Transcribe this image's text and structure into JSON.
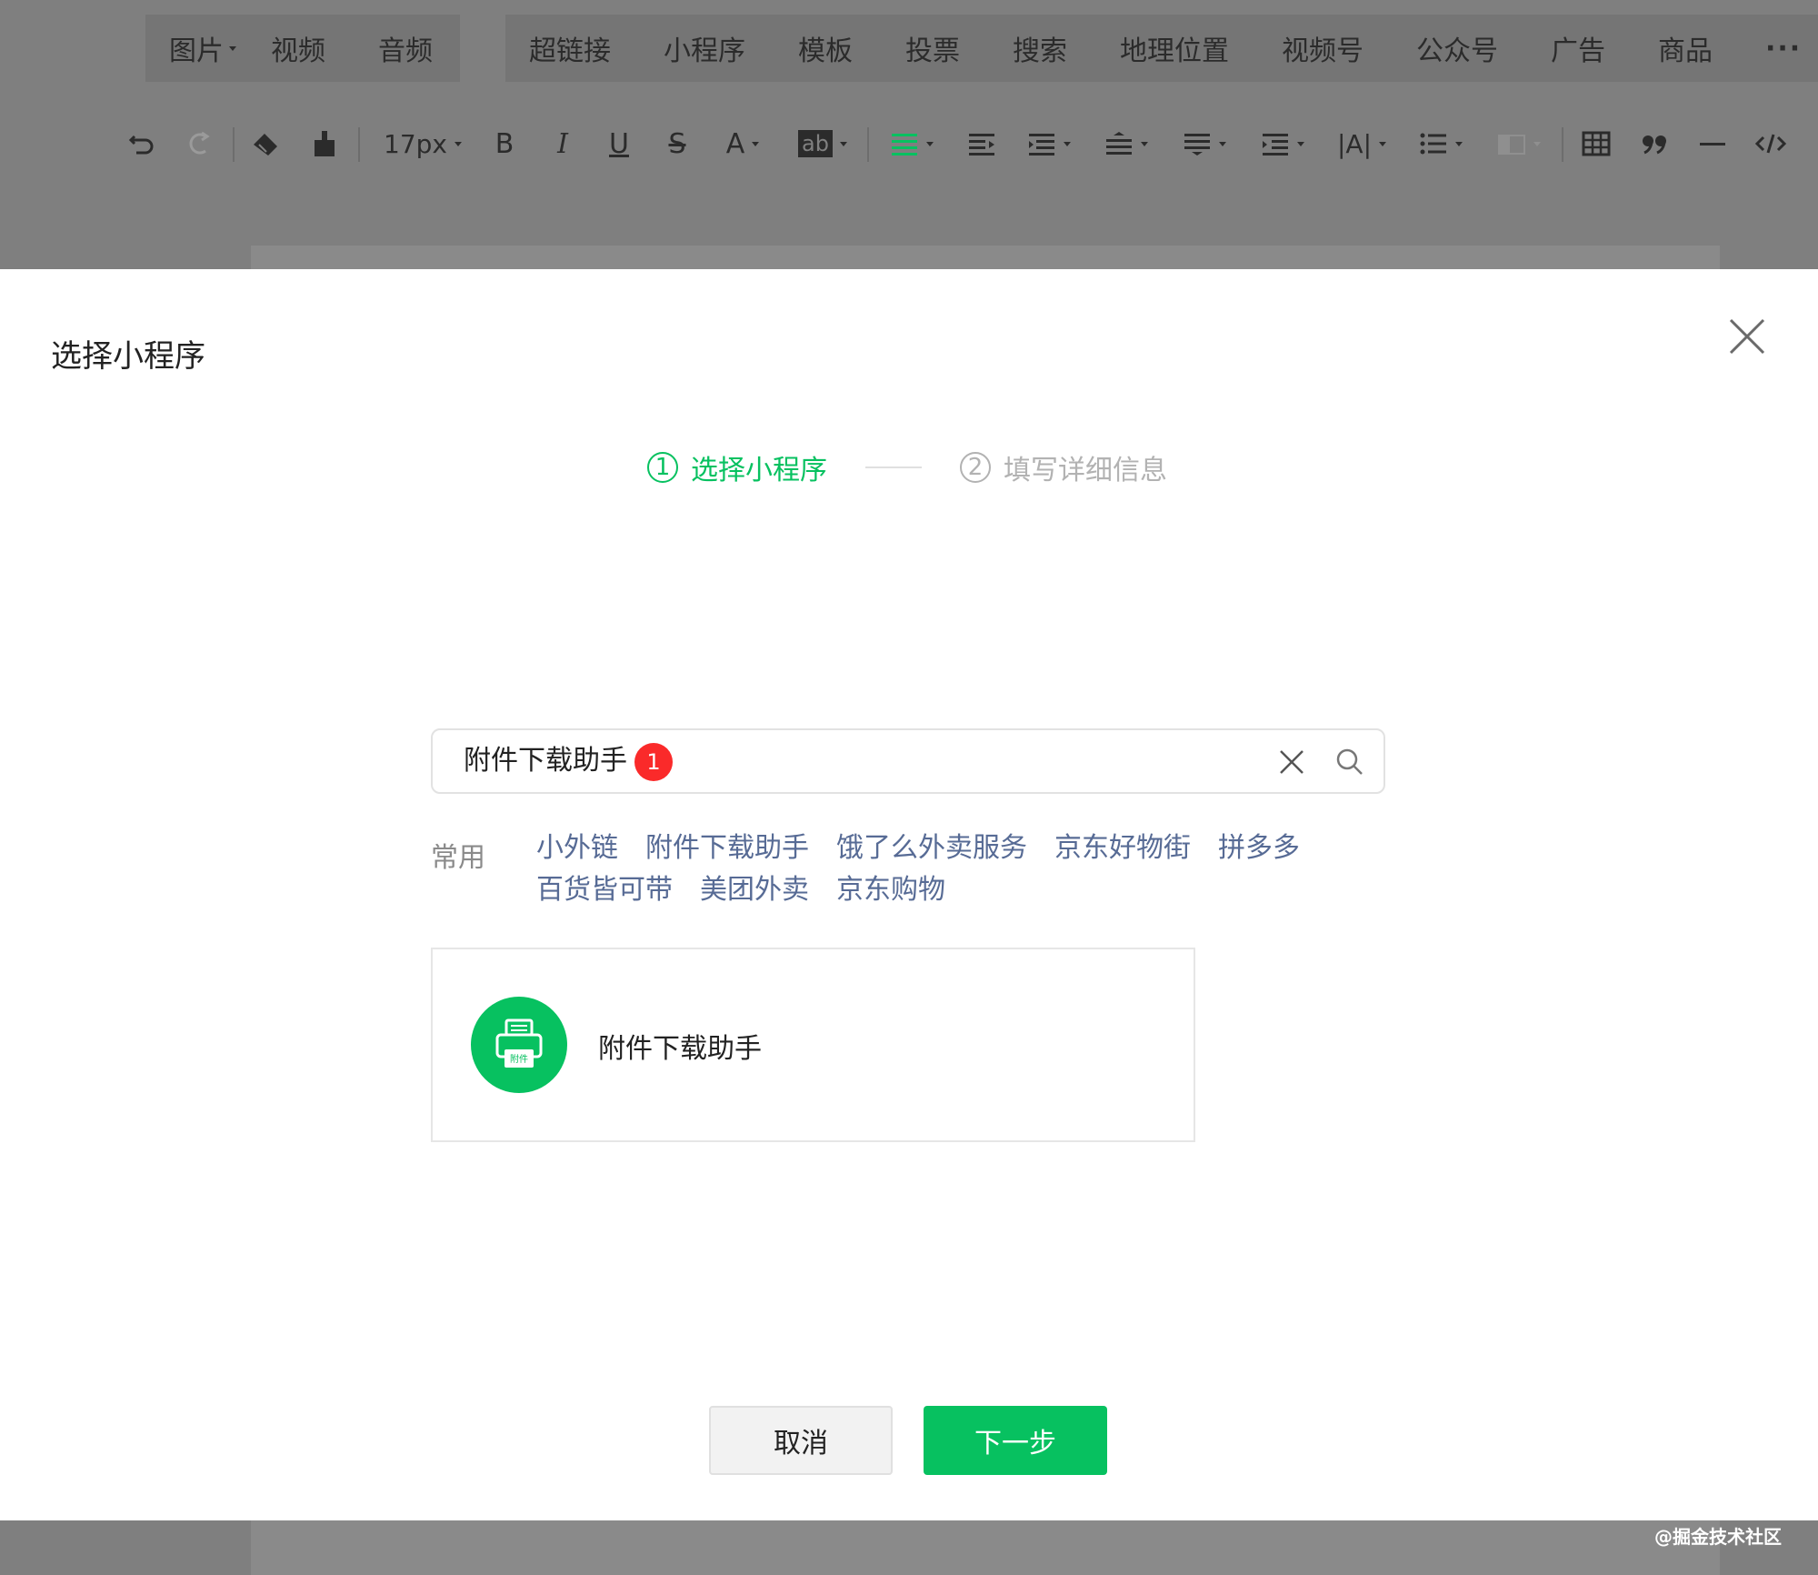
{
  "menu": {
    "group1": [
      {
        "label": "图片",
        "has_caret": true
      },
      {
        "label": "视频"
      },
      {
        "label": "音频"
      }
    ],
    "group2": [
      {
        "label": "超链接"
      },
      {
        "label": "小程序"
      },
      {
        "label": "模板"
      },
      {
        "label": "投票"
      },
      {
        "label": "搜索"
      },
      {
        "label": "地理位置"
      },
      {
        "label": "视频号"
      },
      {
        "label": "公众号"
      },
      {
        "label": "广告"
      },
      {
        "label": "商品"
      }
    ],
    "more": "···"
  },
  "toolbar": {
    "font_size": "17px",
    "bold": "B",
    "italic": "I",
    "underline": "U",
    "strikethrough": "S",
    "font_color": "A",
    "highlight": "ab",
    "letter_spacing": "|A|",
    "icons": [
      "undo-icon",
      "redo-icon",
      "eraser-icon",
      "format-painter-icon",
      "align-justify-icon",
      "align-left-icon",
      "align-center-icon",
      "line-height-icon",
      "paragraph-spacing-icon",
      "indent-icon",
      "letter-spacing-icon",
      "list-icon",
      "disabled-icon",
      "table-icon",
      "quote-icon",
      "divider-icon",
      "code-icon"
    ]
  },
  "dialog": {
    "title": "选择小程序",
    "steps": [
      {
        "num": "1",
        "label": "选择小程序",
        "state": "active"
      },
      {
        "num": "2",
        "label": "填写详细信息",
        "state": "inactive"
      }
    ],
    "search": {
      "value": "附件下载助手",
      "badge": "1"
    },
    "common_label": "常用",
    "tags": [
      "小外链",
      "附件下载助手",
      "饿了么外卖服务",
      "京东好物街",
      "拼多多",
      "百货皆可带",
      "美团外卖",
      "京东购物"
    ],
    "result": {
      "name": "附件下载助手",
      "icon_text": "附件"
    },
    "cancel": "取消",
    "next": "下一步"
  },
  "watermark": "@掘金技术社区",
  "colors": {
    "accent": "#07c160",
    "link": "#576b95",
    "badge": "#fa2a2a"
  }
}
